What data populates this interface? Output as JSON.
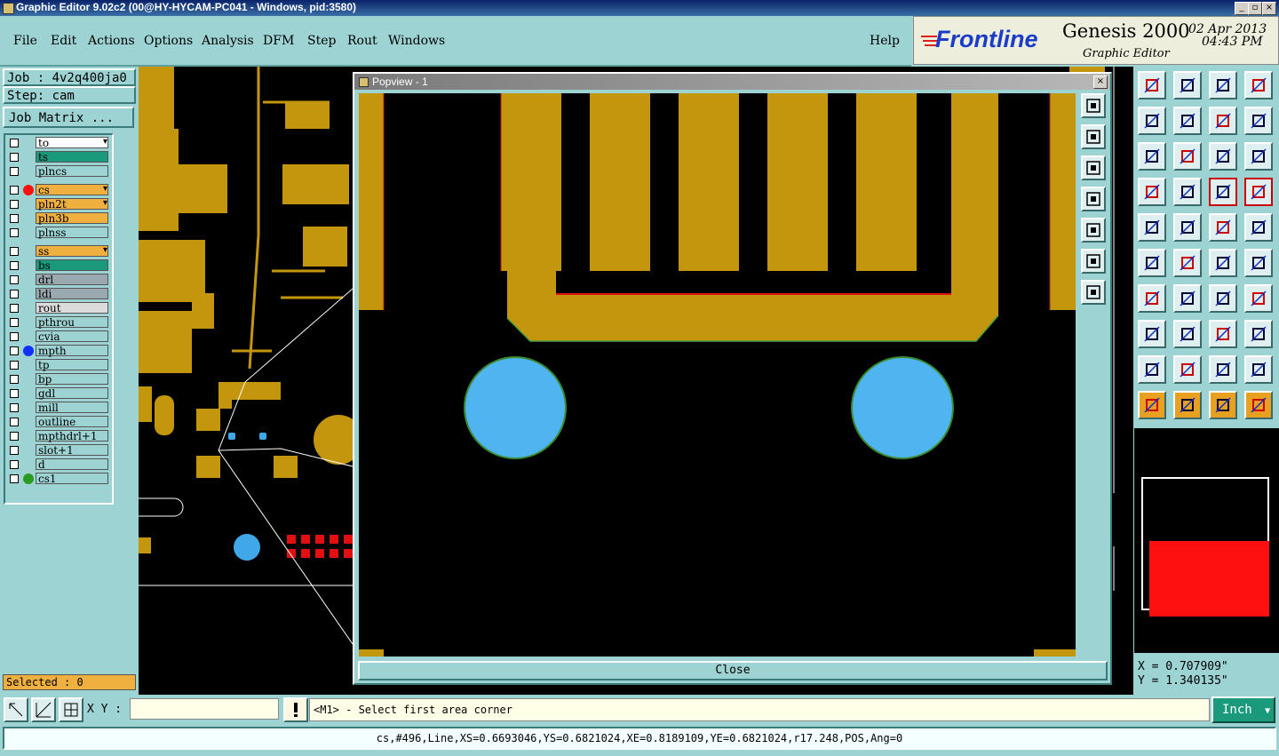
{
  "window": {
    "title": "Graphic Editor 9.02c2 (00@HY-HYCAM-PC041 - Windows, pid:3580)"
  },
  "menu": [
    "File",
    "Edit",
    "Actions",
    "Options",
    "Analysis",
    "DFM",
    "Step",
    "Rout",
    "Windows"
  ],
  "help": "Help",
  "brand": {
    "logo": "Frontline",
    "product": "Genesis 2000",
    "subtitle": "Graphic Editor",
    "date": "02 Apr 2013",
    "time": "04:43 PM"
  },
  "job": {
    "job_label": "Job : 4v2q400ja0",
    "step_label": "Step: cam",
    "matrix_button": "Job Matrix ..."
  },
  "layers": [
    {
      "name": "to",
      "color": "#ffffff",
      "dot": "",
      "flag": true
    },
    {
      "name": "ts",
      "color": "#1a9a7a",
      "dot": "",
      "flag": false
    },
    {
      "name": "plncs",
      "color": "#9ed3d3",
      "dot": "",
      "flag": false
    },
    {
      "name": "cs",
      "color": "#f0b040",
      "dot": "#ff1010",
      "flag": true
    },
    {
      "name": "pln2t",
      "color": "#f0b040",
      "dot": "",
      "flag": true
    },
    {
      "name": "pln3b",
      "color": "#f0b040",
      "dot": "",
      "flag": false
    },
    {
      "name": "plnss",
      "color": "#9ed3d3",
      "dot": "",
      "flag": false
    },
    {
      "name": "ss",
      "color": "#f0b040",
      "dot": "",
      "flag": true
    },
    {
      "name": "bs",
      "color": "#1a9a7a",
      "dot": "",
      "flag": false
    },
    {
      "name": "drl",
      "color": "#9aa8b0",
      "dot": "",
      "flag": false
    },
    {
      "name": "ldi",
      "color": "#9aa8b0",
      "dot": "",
      "flag": false
    },
    {
      "name": "rout",
      "color": "#dcdcdc",
      "dot": "",
      "flag": false
    },
    {
      "name": "pthrou",
      "color": "#9ed3d3",
      "dot": "",
      "flag": false
    },
    {
      "name": "cvia",
      "color": "#9ed3d3",
      "dot": "",
      "flag": false
    },
    {
      "name": "mpth",
      "color": "#9ed3d3",
      "dot": "#1030ff",
      "flag": false
    },
    {
      "name": "tp",
      "color": "#9ed3d3",
      "dot": "",
      "flag": false
    },
    {
      "name": "bp",
      "color": "#9ed3d3",
      "dot": "",
      "flag": false
    },
    {
      "name": "gdl",
      "color": "#9ed3d3",
      "dot": "",
      "flag": false
    },
    {
      "name": "mill",
      "color": "#9ed3d3",
      "dot": "",
      "flag": false
    },
    {
      "name": "outline",
      "color": "#9ed3d3",
      "dot": "",
      "flag": false
    },
    {
      "name": "mpthdrl+1",
      "color": "#9ed3d3",
      "dot": "",
      "flag": false
    },
    {
      "name": "slot+1",
      "color": "#9ed3d3",
      "dot": "",
      "flag": false
    },
    {
      "name": "d",
      "color": "#9ed3d3",
      "dot": "",
      "flag": false
    },
    {
      "name": "cs1",
      "color": "#9ed3d3",
      "dot": "#2a9a20",
      "flag": false
    }
  ],
  "selected": "Selected : 0",
  "popview": {
    "title": "Popview - 1",
    "close_label": "Close"
  },
  "coords": {
    "x": "X = 0.707909\"",
    "y": "Y = 1.340135\""
  },
  "xy_label": "X Y :",
  "xy_value": "",
  "prompt": "<M1> - Select first area corner",
  "units": "Inch",
  "status": "cs,#496,Line,XS=0.6693046,YS=0.6821024,XE=0.8189109,YE=0.6821024,r17.248,POS,Ang=0",
  "tool_icons": [
    "home-up-icon",
    "home-down-icon",
    "house-icon",
    "window-icon",
    "pan-left-icon",
    "pan-right-icon",
    "rotate-icon",
    "snake-icon",
    "fit-icon",
    "center-icon",
    "scale-1-2-icon",
    "help-icon",
    "ruler-icon",
    "grid-icon",
    "panel-active-icon",
    "panel-active2-icon",
    "pad-icon",
    "line-icon",
    "measure-icon",
    "circle-pad-icon",
    "nodes-icon",
    "cross-icon",
    "arc-icon",
    "arc-red-icon",
    "angle-icon",
    "slash-icon",
    "rotate-arc-icon",
    "text-F-icon",
    "select-pad-icon",
    "minus-icon",
    "dimension-icon",
    "pads-icon",
    "triangle-icon",
    "triangle-a-icon",
    "triangle-cross-icon",
    "triangle-x-icon",
    "pointer-icon",
    "pointer-box-icon",
    "pointer-box2-icon",
    "pointer-path-icon"
  ],
  "side_icons": [
    "layout-icon",
    "move-up-icon",
    "move-down-icon",
    "move-left-icon",
    "move-right-icon",
    "fit-all-icon",
    "center-all-icon"
  ]
}
